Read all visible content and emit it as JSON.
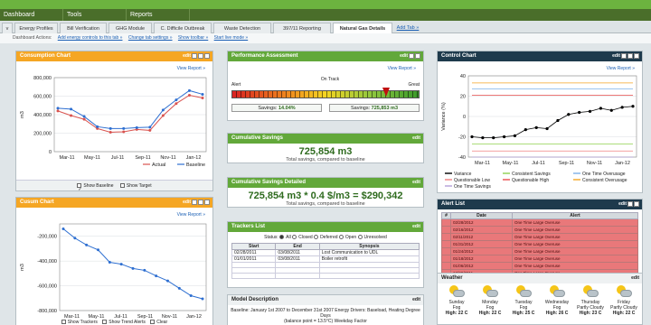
{
  "topbar": {
    "links": ""
  },
  "mainnav": [
    "Dashboard",
    "Tools",
    "Reports"
  ],
  "tabs": [
    {
      "label": "v",
      "active": false
    },
    {
      "label": "Energy Profiles",
      "active": false
    },
    {
      "label": "Bill Verification",
      "active": false
    },
    {
      "label": "GHG Module",
      "active": false
    },
    {
      "label": "C. Difficile Outbreak",
      "active": false
    },
    {
      "label": "Waste Detection",
      "active": false
    },
    {
      "label": "397/11 Reporting",
      "active": false
    },
    {
      "label": "Natural Gas Details",
      "active": true
    }
  ],
  "addtab": "Add Tab »",
  "dashboard_actions": {
    "label": "Dashboard Actions:",
    "links": [
      "Add energy controls to this tab »",
      "Change tab settings »",
      "Show toolbar »",
      "Start live mode »"
    ]
  },
  "consumption": {
    "title": "Consumption Chart",
    "view_report": "View Report »",
    "show_baseline": "Show Baseline",
    "show_target": "Show Target",
    "chart_data": {
      "type": "line",
      "x": [
        "Mar-11",
        "May-11",
        "Jul-11",
        "Sep-11",
        "Nov-11",
        "Jan-12"
      ],
      "categories": [
        "Mar-11",
        "Apr-11",
        "May-11",
        "Jun-11",
        "Jul-11",
        "Aug-11",
        "Sep-11",
        "Oct-11",
        "Nov-11",
        "Dec-11",
        "Jan-12",
        "Feb-12"
      ],
      "series": [
        {
          "name": "Actual",
          "color": "#d9534f",
          "values": [
            440000,
            390000,
            350000,
            250000,
            210000,
            215000,
            240000,
            230000,
            390000,
            520000,
            610000,
            580000
          ]
        },
        {
          "name": "Baseline",
          "color": "#2e6fd1",
          "values": [
            470000,
            460000,
            380000,
            270000,
            250000,
            250000,
            260000,
            265000,
            450000,
            560000,
            660000,
            620000
          ]
        }
      ],
      "ylabel": "m3",
      "yticks": [
        "800,000",
        "600,000",
        "400,000",
        "200,000",
        "0"
      ],
      "ylim": [
        0,
        800000
      ]
    }
  },
  "cusum": {
    "title": "Cusum Chart",
    "view_report": "View Report »",
    "show_trackers": "Show Trackers",
    "show_trend_alerts": "Show Trend Alerts",
    "clear": "Clear",
    "chart_data": {
      "type": "line",
      "x": [
        "Mar-11",
        "May-11",
        "Jul-11",
        "Sep-11",
        "Nov-11",
        "Jan-12"
      ],
      "series": [
        {
          "name": "",
          "color": "#2e6fd1",
          "values": [
            -140000,
            -215000,
            -270000,
            -310000,
            -410000,
            -425000,
            -460000,
            -475000,
            -520000,
            -560000,
            -620000,
            -680000,
            -705000
          ]
        }
      ],
      "ylabel": "m3",
      "yticks": [
        "-200,000",
        "-400,000",
        "-600,000",
        "-800,000"
      ],
      "ylim": [
        -800000,
        -100000
      ]
    }
  },
  "performance": {
    "title": "Performance Assessment",
    "view_report": "View Report »",
    "labels": {
      "left": "Alert",
      "center": "On Track",
      "right": "Great"
    },
    "savings_left_label": "Savings:",
    "savings_left_value": "14.04%",
    "savings_right_label": "Savings:",
    "savings_right_value": "725,853 m3",
    "gauge_position": 0.82
  },
  "cumulative": {
    "title": "Cumulative Savings",
    "value": "725,854 m3",
    "sub": "Total savings, compared to baseline"
  },
  "cumulative_detailed": {
    "title": "Cumulative Savings Detailed",
    "value": "725,854 m3 * 0.4 $/m3 = $290,342",
    "sub": "Total savings, compared to baseline"
  },
  "trackers": {
    "title": "Trackers List",
    "status_label": "Status:",
    "statuses": [
      "All",
      "Closed",
      "Deferred",
      "Open",
      "Unresolved"
    ],
    "columns": [
      "Start",
      "End",
      "Synopsis"
    ],
    "rows": [
      [
        "02/28/2011",
        "03/08/2011",
        "Lost Communication to UDL"
      ],
      [
        "01/01/2011",
        "03/08/2011",
        "Boiler retrofit"
      ],
      [
        "",
        "",
        ""
      ],
      [
        "",
        "",
        ""
      ],
      [
        "",
        "",
        ""
      ]
    ]
  },
  "model": {
    "title": "Model Description",
    "line1": "Baseline: January 1st 2007 to December 31st 2007 Energy Drivers: Baseload, Heating Degree Days",
    "line2": "(balance point = 13.5°C) Weekday Factor"
  },
  "control": {
    "title": "Control Chart",
    "view_report": "View Report »",
    "chart_data": {
      "type": "line",
      "x": [
        "Mar-11",
        "May-11",
        "Jul-11",
        "Sep-11",
        "Nov-11",
        "Jan-12"
      ],
      "series": [
        {
          "name": "Variance",
          "color": "#000000",
          "values": [
            -20,
            -21,
            -21,
            -20,
            -19,
            -13,
            -11,
            -12,
            -4,
            2,
            4,
            5,
            8,
            6,
            9,
            10
          ]
        },
        {
          "name": "Consistent Savings",
          "color": "#8fd14f",
          "values": [
            -27,
            -27,
            -27,
            -27,
            -27,
            -27,
            -27,
            -27,
            -27,
            -27,
            -27,
            -27,
            -27,
            -27,
            -27,
            -27
          ]
        },
        {
          "name": "One Time Overusage",
          "color": "#7db1e8",
          "values": [
            27,
            27,
            27,
            27,
            27,
            27,
            27,
            27,
            27,
            27,
            27,
            27,
            27,
            27,
            27,
            27
          ]
        },
        {
          "name": "Questionable Low",
          "color": "#f08080",
          "values": [
            -34,
            -34,
            -34,
            -34,
            -34,
            -34,
            -34,
            -34,
            -34,
            -34,
            -34,
            -34,
            -34,
            -34,
            -34,
            -34
          ]
        },
        {
          "name": "Questionable High",
          "color": "#e94c4c",
          "values": [
            21,
            21,
            21,
            21,
            21,
            21,
            21,
            21,
            21,
            21,
            21,
            21,
            21,
            21,
            21,
            21
          ]
        },
        {
          "name": "Consistent Overusage",
          "color": "#f5a623",
          "values": [
            33,
            33,
            33,
            33,
            33,
            33,
            33,
            33,
            33,
            33,
            33,
            33,
            33,
            33,
            33,
            33
          ]
        },
        {
          "name": "One Time Savings",
          "color": "#b3a0d9",
          "values": [
            -40,
            -40,
            -40,
            -40,
            -40,
            -40,
            -40,
            -40,
            -40,
            -40,
            -40,
            -40,
            -40,
            -40,
            -40,
            -40
          ]
        }
      ],
      "ylabel": "Variance (%)",
      "yticks": [
        "40",
        "20",
        "0",
        "-20",
        "-40"
      ],
      "ylim": [
        -40,
        40
      ]
    }
  },
  "alerts": {
    "title": "Alert List",
    "columns": [
      "#",
      "Date",
      "Alert"
    ],
    "rows": [
      [
        "",
        "02/28/2012",
        "One Time Large Overuse"
      ],
      [
        "",
        "02/16/2012",
        "One Time Large Overuse"
      ],
      [
        "",
        "02/11/2012",
        "One Time Large Overuse"
      ],
      [
        "",
        "01/31/2012",
        "One Time Large Overuse"
      ],
      [
        "",
        "01/24/2012",
        "One Time Large Overuse"
      ],
      [
        "",
        "01/18/2012",
        "One Time Large Overuse"
      ],
      [
        "",
        "01/06/2012",
        "One Time Large Overuse"
      ],
      [
        "",
        "12/28/2011",
        "One Time Large Overuse"
      ]
    ]
  },
  "weather": {
    "title": "Weather",
    "days": [
      {
        "day": "Sunday",
        "cond": "Fog",
        "high": "High: 22 C"
      },
      {
        "day": "Monday",
        "cond": "Fog",
        "high": "High: 22 C"
      },
      {
        "day": "Tuesday",
        "cond": "Fog",
        "high": "High: 25 C"
      },
      {
        "day": "Wednesday",
        "cond": "Fog",
        "high": "High: 26 C"
      },
      {
        "day": "Thursday",
        "cond": "Partly Cloudy",
        "high": "High: 23 C"
      },
      {
        "day": "Friday",
        "cond": "Partly Cloudy",
        "high": "High: 22 C"
      }
    ]
  },
  "edit_label": "edit"
}
